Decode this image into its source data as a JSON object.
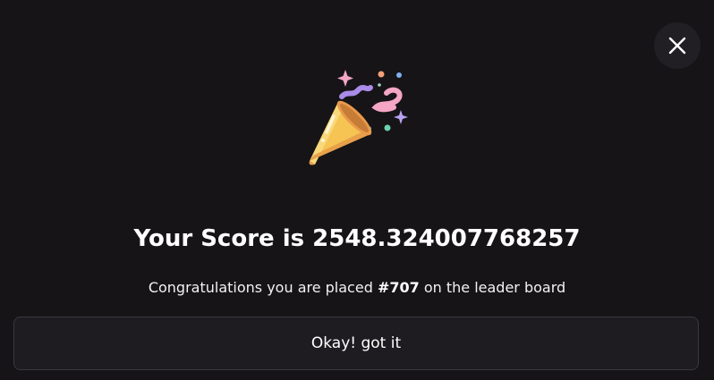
{
  "dialog": {
    "close_icon": "close-icon",
    "celebration_icon": "party-popper-icon",
    "title": "Your Score is 2548.324007768257",
    "message_prefix": "Congratulations you are placed ",
    "rank": "#707",
    "message_suffix": " on the leader board",
    "confirm_label": "Okay! got it"
  },
  "colors": {
    "background": "#161417",
    "button_background": "#1e1c20",
    "button_border": "#3a383c",
    "close_background": "#211f23",
    "text": "#ffffff"
  }
}
